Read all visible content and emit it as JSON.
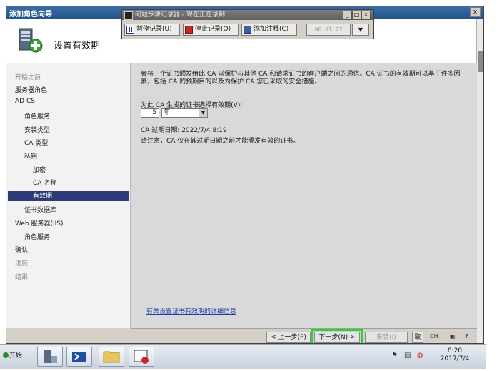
{
  "wizard": {
    "window_title": "添加角色向导",
    "close_label": "x",
    "page_title": "设置有效期",
    "nav_items": [
      {
        "label": "开始之前",
        "state": "dim"
      },
      {
        "label": "服务器角色",
        "state": "normal"
      },
      {
        "label": "AD CS",
        "state": "normal"
      },
      {
        "label": "角色服务",
        "state": "normal"
      },
      {
        "label": "安装类型",
        "state": "normal"
      },
      {
        "label": "CA 类型",
        "state": "normal"
      },
      {
        "label": "私钥",
        "state": "normal"
      },
      {
        "label": "加密",
        "state": "normal"
      },
      {
        "label": "CA 名称",
        "state": "normal"
      },
      {
        "label": "有效期",
        "state": "selected"
      },
      {
        "label": "证书数据库",
        "state": "normal"
      },
      {
        "label": "Web 服务器(IIS)",
        "state": "normal"
      },
      {
        "label": "角色服务",
        "state": "normal"
      },
      {
        "label": "确认",
        "state": "normal"
      },
      {
        "label": "进度",
        "state": "dim"
      },
      {
        "label": "结果",
        "state": "dim"
      }
    ],
    "description": "会将一个证书颁发给此 CA 以保护与其他 CA 和请求证书的客户端之间的通信。CA 证书的有效期可以基于许多因素，包括 CA 的预期目的以及为保护 CA 您已采取的安全措施。",
    "validity_prompt": "为此 CA 生成的证书选择有效期(V):",
    "validity_value": "5",
    "validity_unit": "年",
    "expiry_label": "CA 过期日期:  2022/7/4 8:19",
    "expiry_note": "请注意，CA 仅在其过期日期之前才能颁发有效的证书。",
    "help_link": "有关设置证书有效期的详细信息",
    "buttons": {
      "prev": "< 上一步(P)",
      "next": "下一步(N) >",
      "install": "安装(I)",
      "cancel": "取消"
    }
  },
  "recorder": {
    "title": "问题步骤记录器 - 现在正在录制",
    "pause": "暂停记录(U)",
    "stop": "停止记录(O)",
    "add_comment": "添加注释(C)",
    "timer": "00:01:27"
  },
  "taskbar": {
    "start": "开始",
    "lang": "CH",
    "time": "8:20",
    "date": "2017/7/4"
  },
  "colors": {
    "selection": "#2b3b7a",
    "highlight": "#29d13a",
    "link": "#1c3fa8"
  }
}
